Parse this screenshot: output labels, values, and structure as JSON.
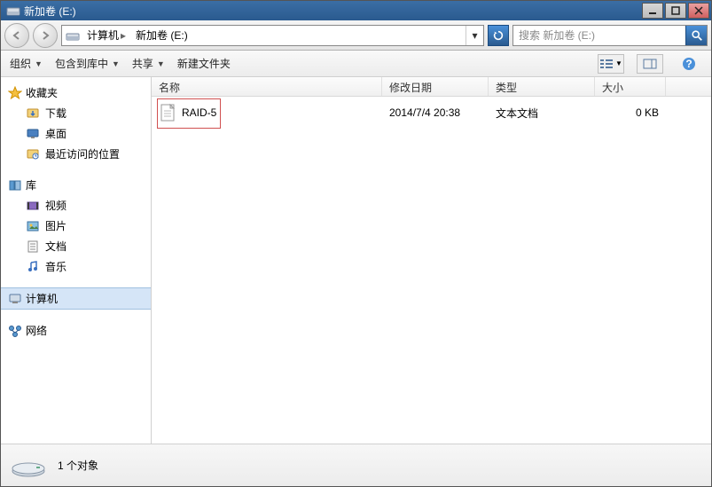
{
  "window": {
    "title": "新加卷 (E:)"
  },
  "nav": {
    "crumbs": [
      "计算机",
      "新加卷 (E:)"
    ],
    "search_placeholder": "搜索 新加卷 (E:)"
  },
  "toolbar": {
    "organize": "组织",
    "include": "包含到库中",
    "share": "共享",
    "newfolder": "新建文件夹"
  },
  "sidebar": {
    "favorites": {
      "label": "收藏夹",
      "items": [
        "下载",
        "桌面",
        "最近访问的位置"
      ]
    },
    "libraries": {
      "label": "库",
      "items": [
        "视频",
        "图片",
        "文档",
        "音乐"
      ]
    },
    "computer": {
      "label": "计算机"
    },
    "network": {
      "label": "网络"
    }
  },
  "columns": {
    "name": "名称",
    "date": "修改日期",
    "type": "类型",
    "size": "大小"
  },
  "files": [
    {
      "name": "RAID-5",
      "date": "2014/7/4 20:38",
      "type": "文本文档",
      "size": "0 KB"
    }
  ],
  "status": {
    "count": "1 个对象"
  }
}
